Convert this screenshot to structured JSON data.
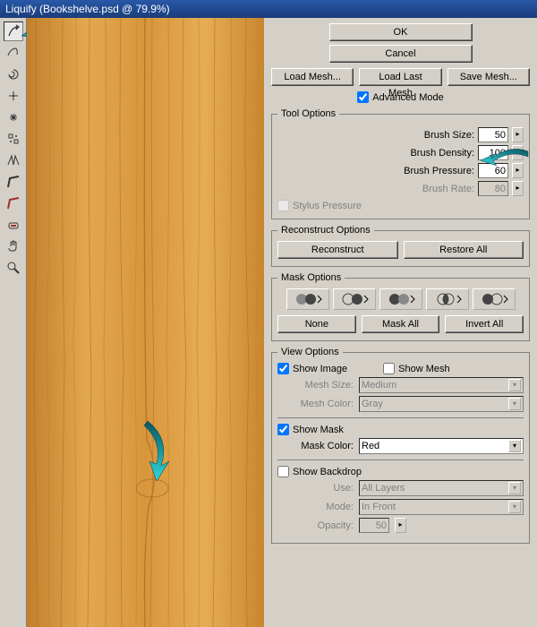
{
  "title": "Liquify (Bookshelve.psd @ 79.9%)",
  "buttons": {
    "ok": "OK",
    "cancel": "Cancel",
    "loadMesh": "Load Mesh...",
    "loadLastMesh": "Load Last Mesh",
    "saveMesh": "Save Mesh...",
    "reconstruct": "Reconstruct",
    "restoreAll": "Restore All",
    "none": "None",
    "maskAll": "Mask All",
    "invertAll": "Invert All"
  },
  "checks": {
    "advancedMode": "Advanced Mode",
    "stylusPressure": "Stylus Pressure",
    "showImage": "Show Image",
    "showMesh": "Show Mesh",
    "showMask": "Show Mask",
    "showBackdrop": "Show Backdrop"
  },
  "groups": {
    "toolOptions": "Tool Options",
    "reconstructOptions": "Reconstruct Options",
    "maskOptions": "Mask Options",
    "viewOptions": "View Options"
  },
  "labels": {
    "brushSize": "Brush Size:",
    "brushDensity": "Brush Density:",
    "brushPressure": "Brush Pressure:",
    "brushRate": "Brush Rate:",
    "meshSize": "Mesh Size:",
    "meshColor": "Mesh Color:",
    "maskColor": "Mask Color:",
    "use": "Use:",
    "mode": "Mode:",
    "opacity": "Opacity:"
  },
  "values": {
    "brushSize": "50",
    "brushDensity": "100",
    "brushPressure": "60",
    "brushRate": "80",
    "meshSize": "Medium",
    "meshColor": "Gray",
    "maskColor": "Red",
    "use": "All Layers",
    "mode": "In Front",
    "opacity": "50"
  },
  "tools": [
    "forward-warp",
    "reconstruct",
    "twirl",
    "pucker",
    "bloat",
    "push-left",
    "mirror",
    "turbulence",
    "freeze-mask",
    "thaw-mask",
    "hand",
    "zoom"
  ]
}
